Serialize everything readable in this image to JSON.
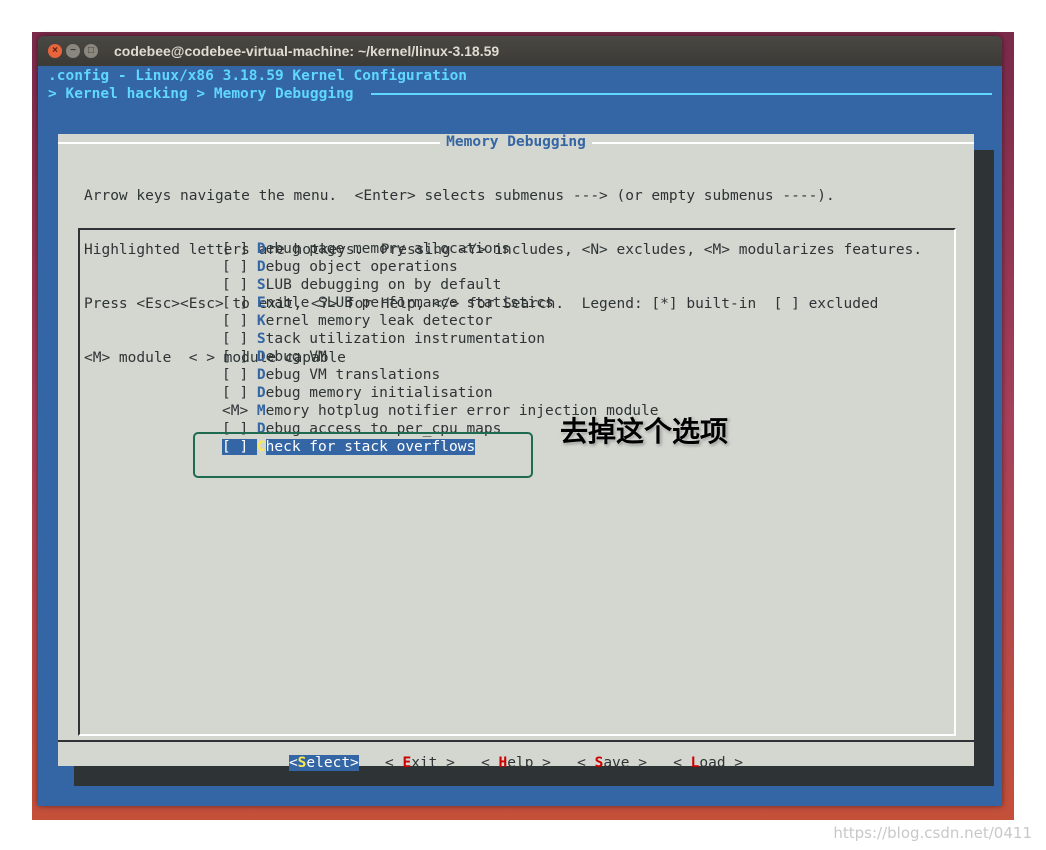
{
  "window": {
    "title": "codebee@codebee-virtual-machine: ~/kernel/linux-3.18.59"
  },
  "header": {
    "config_line": ".config - Linux/x86 3.18.59 Kernel Configuration",
    "breadcrumb": "> Kernel hacking > Memory Debugging"
  },
  "dialog": {
    "title": "Memory Debugging",
    "help_lines": [
      "Arrow keys navigate the menu.  <Enter> selects submenus ---> (or empty submenus ----).",
      "Highlighted letters are hotkeys.  Pressing <Y> includes, <N> excludes, <M> modularizes features.",
      "Press <Esc><Esc> to exit, <?> for Help, </> for Search.  Legend: [*] built-in  [ ] excluded",
      "<M> module  < > module capable"
    ]
  },
  "menu": {
    "items": [
      {
        "prefix": "[ ] ",
        "hotkey": "D",
        "rest": "ebug page memory allocations"
      },
      {
        "prefix": "[ ] ",
        "hotkey": "D",
        "rest": "ebug object operations"
      },
      {
        "prefix": "[ ] ",
        "hotkey": "S",
        "rest": "LUB debugging on by default"
      },
      {
        "prefix": "[ ] ",
        "hotkey": "E",
        "rest": "nable SLUB performance statistics"
      },
      {
        "prefix": "[ ] ",
        "hotkey": "K",
        "rest": "ernel memory leak detector"
      },
      {
        "prefix": "[ ] ",
        "hotkey": "S",
        "rest": "tack utilization instrumentation"
      },
      {
        "prefix": "[ ] ",
        "hotkey": "D",
        "rest": "ebug VM"
      },
      {
        "prefix": "[ ] ",
        "hotkey": "D",
        "rest": "ebug VM translations"
      },
      {
        "prefix": "[ ] ",
        "hotkey": "D",
        "rest": "ebug memory initialisation"
      },
      {
        "prefix": "<M> ",
        "hotkey": "M",
        "rest": "emory hotplug notifier error injection module"
      },
      {
        "prefix": "[ ] ",
        "hotkey": "D",
        "rest": "ebug access to per_cpu maps"
      },
      {
        "prefix": "[ ] ",
        "hotkey": "C",
        "rest": "heck for stack overflows"
      }
    ]
  },
  "buttons": {
    "select": {
      "pre": "<",
      "hotkey": "S",
      "rest": "elect>"
    },
    "exit": {
      "pre": "< ",
      "hotkey": "E",
      "rest": "xit >"
    },
    "help": {
      "pre": "< ",
      "hotkey": "H",
      "rest": "elp >"
    },
    "save": {
      "pre": "< ",
      "hotkey": "S",
      "rest": "ave >"
    },
    "load": {
      "pre": "< ",
      "hotkey": "L",
      "rest": "oad >"
    }
  },
  "annotation": {
    "text": "去掉这个选项"
  },
  "watermark": {
    "text": "https://blog.csdn.net/0411"
  }
}
